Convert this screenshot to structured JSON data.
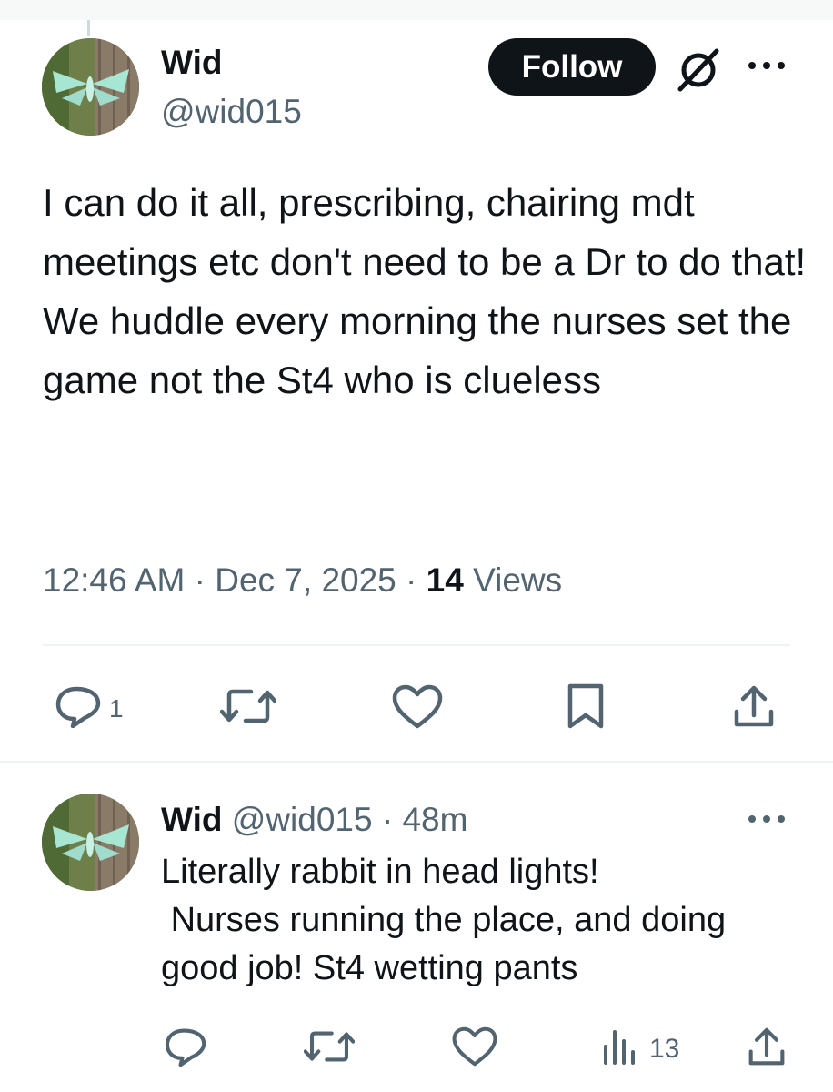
{
  "tweet": {
    "author_name": "Wid",
    "author_handle": "@wid015",
    "follow_label": "Follow",
    "text": "I can do it all, prescribing, chairing mdt meetings etc don't need to be a Dr to do that!\nWe huddle every morning the nurses set the game not the St4 who is clueless",
    "time": "12:46 AM",
    "date": "Dec 7, 2025",
    "views_count": "14",
    "views_label": "Views",
    "reply_count": "1"
  },
  "reply": {
    "author_name": "Wid",
    "author_handle": "@wid015",
    "age": "48m",
    "text": "Literally rabbit in head lights!\n Nurses running the place, and doing good job! St4 wetting pants",
    "views_count": "13"
  },
  "icons": {
    "grok": "grok-icon",
    "more": "more-horizontal-icon",
    "reply": "reply-icon",
    "retweet": "retweet-icon",
    "like": "heart-icon",
    "bookmark": "bookmark-icon",
    "share": "share-icon",
    "views": "views-bar-chart-icon"
  },
  "colors": {
    "text": "#0f1419",
    "secondary": "#536471",
    "follow_bg": "#0f1419",
    "divider": "#eff3f4"
  }
}
